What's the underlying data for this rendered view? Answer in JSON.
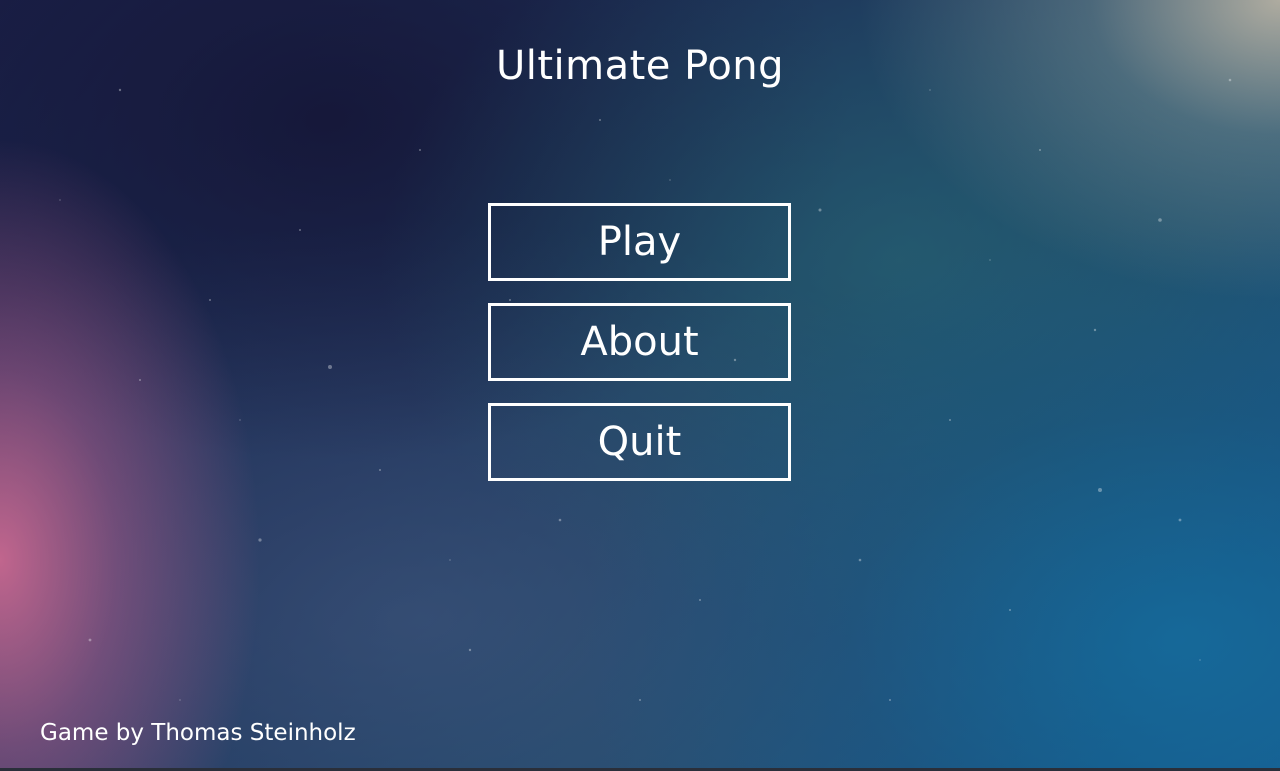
{
  "game": {
    "title": "Ultimate Pong"
  },
  "menu": {
    "buttons": [
      {
        "label": "Play"
      },
      {
        "label": "About"
      },
      {
        "label": "Quit"
      }
    ]
  },
  "footer": {
    "credit": "Game by Thomas Steinholz"
  },
  "colors": {
    "text": "#ffffff",
    "button_border": "#ffffff",
    "background_base": "#1c2c52"
  }
}
